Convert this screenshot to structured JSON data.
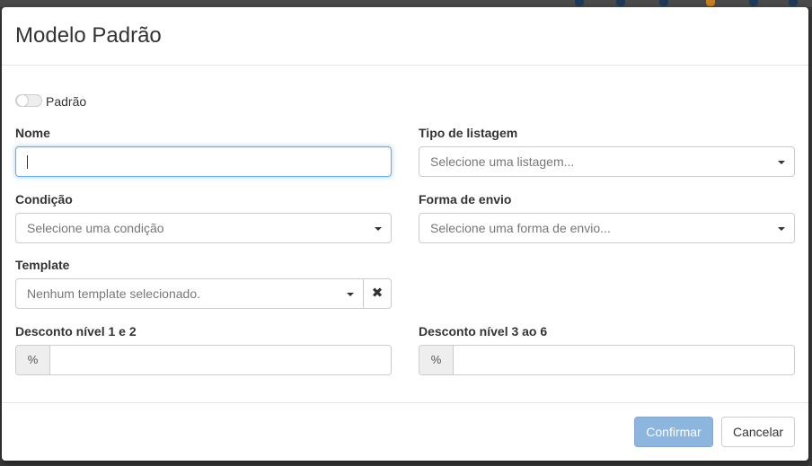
{
  "modal": {
    "title": "Modelo Padrão"
  },
  "form": {
    "default_toggle_label": "Padrão",
    "nome": {
      "label": "Nome",
      "value": ""
    },
    "tipo_listagem": {
      "label": "Tipo de listagem",
      "placeholder": "Selecione uma listagem..."
    },
    "condicao": {
      "label": "Condição",
      "placeholder": "Selecione uma condição"
    },
    "forma_envio": {
      "label": "Forma de envio",
      "placeholder": "Selecione uma forma de envio..."
    },
    "template": {
      "label": "Template",
      "placeholder": "Nenhum template selecionado.",
      "clear_symbol": "✖"
    },
    "desconto_1_2": {
      "label": "Desconto nível 1 e 2",
      "addon": "%",
      "value": ""
    },
    "desconto_3_6": {
      "label": "Desconto nível 3 ao 6",
      "addon": "%",
      "value": ""
    }
  },
  "footer": {
    "confirm_label": "Confirmar",
    "cancel_label": "Cancelar"
  },
  "colors": {
    "primary_disabled": "#8db6de",
    "focus_border": "#66afe9"
  }
}
